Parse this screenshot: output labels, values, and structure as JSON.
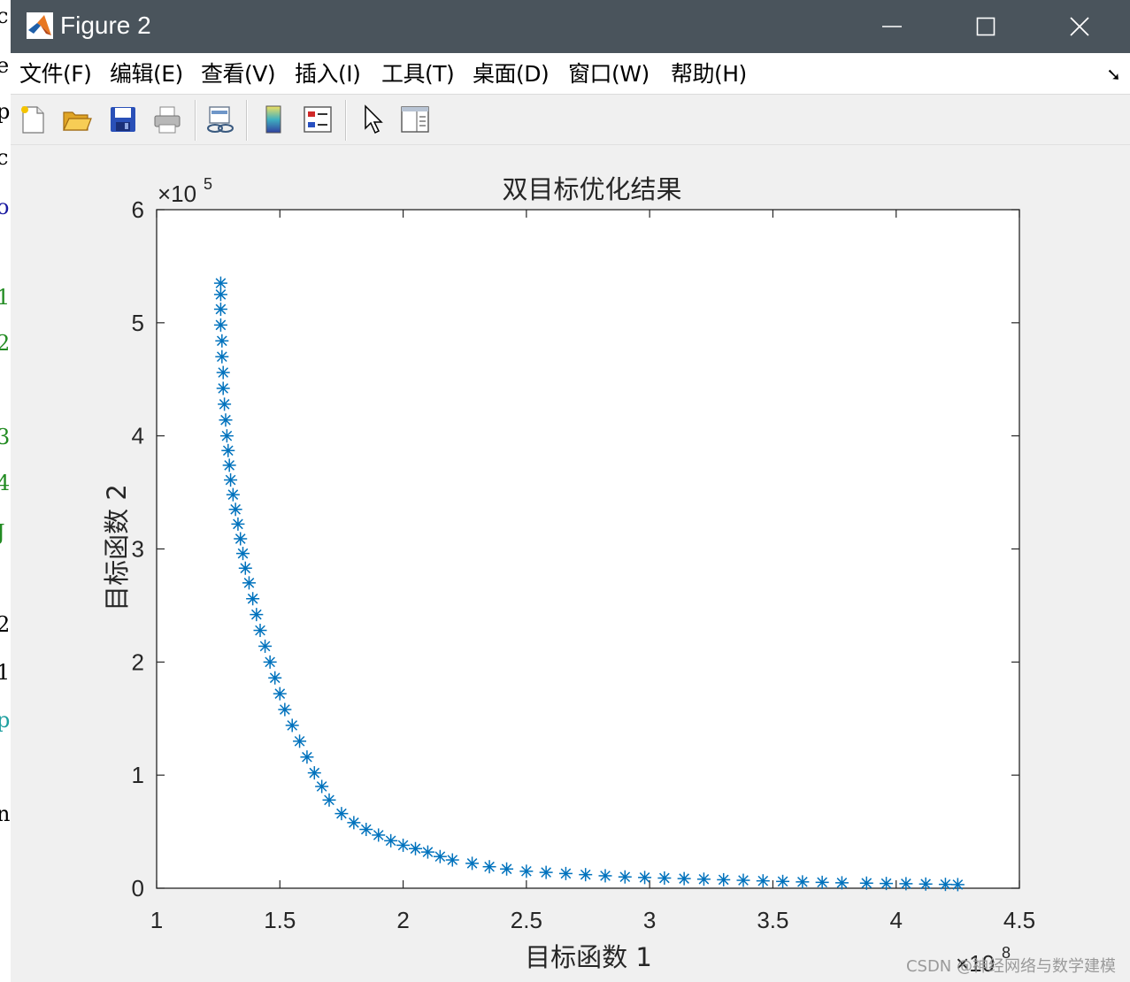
{
  "window": {
    "title": "Figure 2",
    "controls": {
      "minimize": "minimize",
      "maximize": "maximize",
      "close": "close"
    }
  },
  "menu": [
    {
      "label": "文件(F)"
    },
    {
      "label": "编辑(E)"
    },
    {
      "label": "查看(V)"
    },
    {
      "label": "插入(I)"
    },
    {
      "label": "工具(T)"
    },
    {
      "label": "桌面(D)"
    },
    {
      "label": "窗口(W)"
    },
    {
      "label": "帮助(H)"
    }
  ],
  "toolbar": [
    {
      "icon": "new-figure-icon"
    },
    {
      "icon": "open-file-icon"
    },
    {
      "icon": "save-icon"
    },
    {
      "icon": "print-icon"
    },
    {
      "icon": "link-plot-icon"
    },
    {
      "icon": "colorbar-icon"
    },
    {
      "icon": "legend-icon"
    },
    {
      "icon": "pointer-icon"
    },
    {
      "icon": "property-inspector-icon"
    }
  ],
  "colors": {
    "marker": "#0072bd",
    "titlebar": "#4a545c",
    "axes_bg": "#ffffff"
  },
  "chart_data": {
    "type": "scatter",
    "title": "双目标优化结果",
    "xlabel": "目标函数 1",
    "ylabel": "目标函数 2",
    "xlim": [
      1,
      4.5
    ],
    "ylim": [
      0,
      6
    ],
    "x_exponent": "8",
    "y_exponent": "5",
    "x_ticks": [
      "1",
      "1.5",
      "2",
      "2.5",
      "3",
      "3.5",
      "4",
      "4.5"
    ],
    "y_ticks": [
      "0",
      "1",
      "2",
      "3",
      "4",
      "5",
      "6"
    ],
    "marker": "*",
    "grid": false,
    "x": [
      1.26,
      1.26,
      1.26,
      1.26,
      1.265,
      1.265,
      1.27,
      1.27,
      1.275,
      1.28,
      1.285,
      1.29,
      1.295,
      1.3,
      1.31,
      1.32,
      1.33,
      1.34,
      1.35,
      1.36,
      1.375,
      1.39,
      1.405,
      1.42,
      1.44,
      1.46,
      1.48,
      1.5,
      1.52,
      1.55,
      1.58,
      1.61,
      1.64,
      1.67,
      1.7,
      1.75,
      1.8,
      1.85,
      1.9,
      1.95,
      2.0,
      2.05,
      2.1,
      2.15,
      2.2,
      2.28,
      2.35,
      2.42,
      2.5,
      2.58,
      2.66,
      2.74,
      2.82,
      2.9,
      2.98,
      3.06,
      3.14,
      3.22,
      3.3,
      3.38,
      3.46,
      3.54,
      3.62,
      3.7,
      3.78,
      3.88,
      3.96,
      4.04,
      4.12,
      4.2,
      4.25
    ],
    "y": [
      5.35,
      5.25,
      5.12,
      4.98,
      4.84,
      4.7,
      4.56,
      4.42,
      4.28,
      4.14,
      4.0,
      3.87,
      3.74,
      3.61,
      3.48,
      3.35,
      3.22,
      3.09,
      2.96,
      2.83,
      2.7,
      2.56,
      2.42,
      2.28,
      2.14,
      2.0,
      1.86,
      1.72,
      1.58,
      1.44,
      1.3,
      1.16,
      1.02,
      0.9,
      0.78,
      0.66,
      0.58,
      0.52,
      0.47,
      0.42,
      0.38,
      0.35,
      0.32,
      0.28,
      0.25,
      0.22,
      0.19,
      0.17,
      0.15,
      0.14,
      0.13,
      0.12,
      0.11,
      0.1,
      0.095,
      0.09,
      0.085,
      0.08,
      0.075,
      0.07,
      0.065,
      0.06,
      0.056,
      0.052,
      0.048,
      0.045,
      0.042,
      0.04,
      0.037,
      0.034,
      0.032
    ]
  },
  "watermark": "CSDN @神经网络与数学建模"
}
